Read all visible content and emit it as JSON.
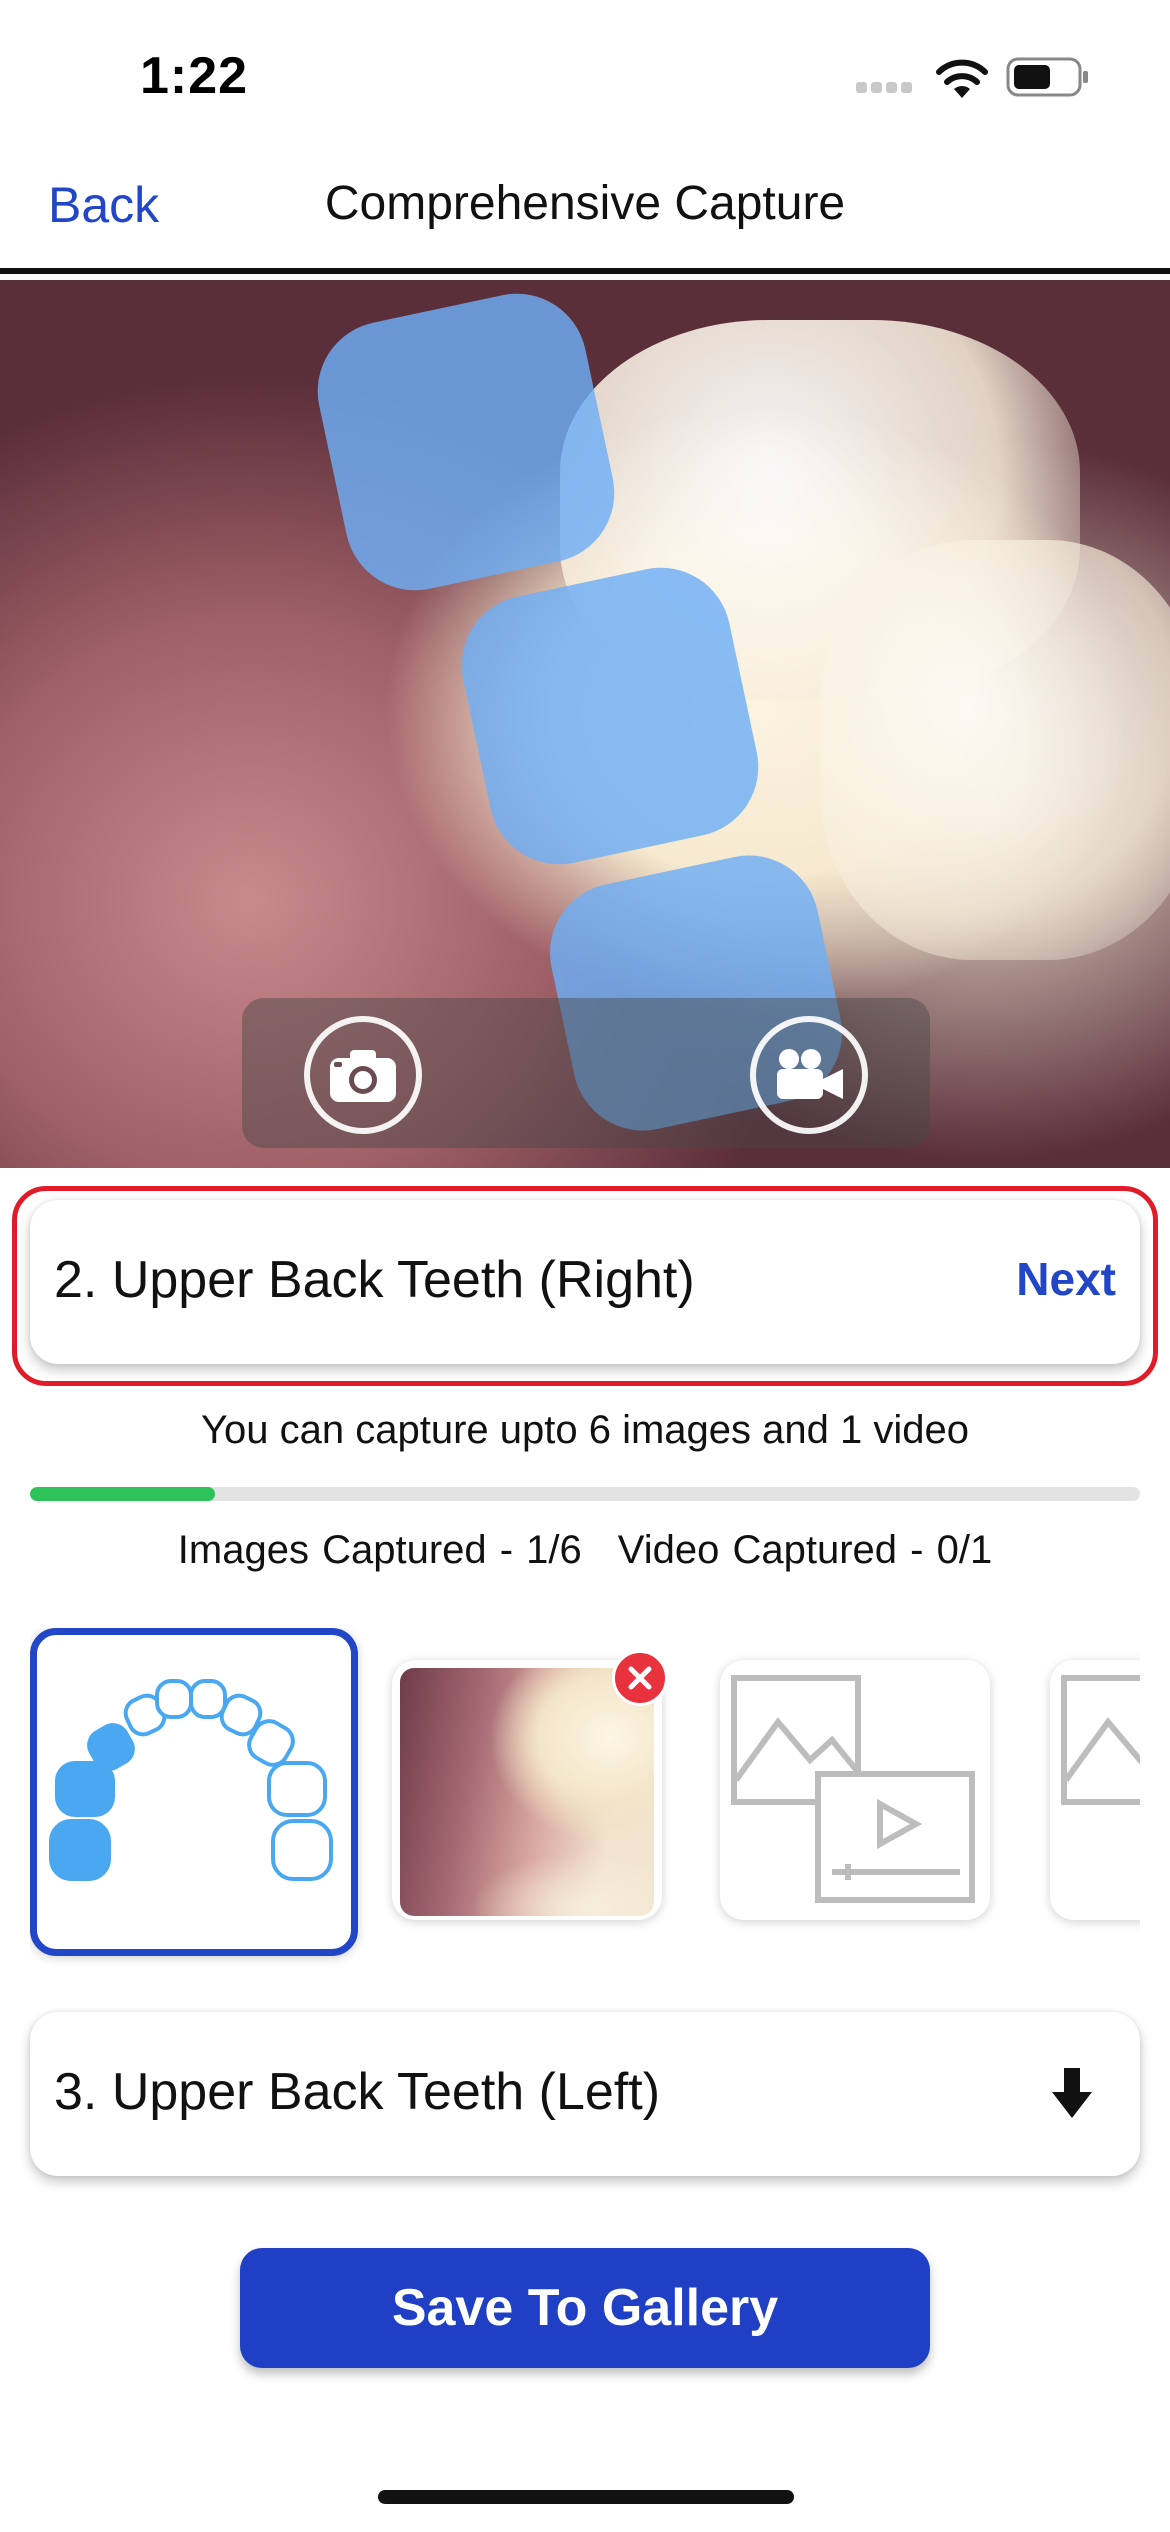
{
  "status_bar": {
    "time": "1:22",
    "icons": [
      "signal-icon",
      "wifi-icon",
      "battery-icon"
    ]
  },
  "nav": {
    "back_label": "Back",
    "title": "Comprehensive Capture"
  },
  "camera": {
    "controls": [
      "camera-icon",
      "video-camera-icon"
    ],
    "overlay_color": "#6eaff5"
  },
  "current_section": {
    "title": "2. Upper Back Teeth (Right)",
    "next_label": "Next",
    "highlight_color": "#e01c2a"
  },
  "capture_info": {
    "note": "You can capture upto 6 images and 1 video",
    "progress_fraction": 0.1667,
    "images_captured": "Images Captured - 1/6",
    "video_captured": "Video Captured - 0/1"
  },
  "thumbnails": [
    {
      "type": "tooth-chart",
      "icon": "upper-arch-icon",
      "selected": true
    },
    {
      "type": "photo",
      "deletable": true,
      "delete_icon": "close-icon"
    },
    {
      "type": "placeholder",
      "icon": "image-video-placeholder-icon"
    },
    {
      "type": "placeholder",
      "icon": "image-placeholder-icon"
    }
  ],
  "next_section": {
    "title": "3. Upper Back Teeth (Left)",
    "icon": "arrow-down-icon"
  },
  "actions": {
    "save_label": "Save To Gallery"
  },
  "colors": {
    "accent": "#2246c8",
    "button": "#1f3fc4",
    "progress": "#2ec35a",
    "delete": "#e8323d"
  }
}
